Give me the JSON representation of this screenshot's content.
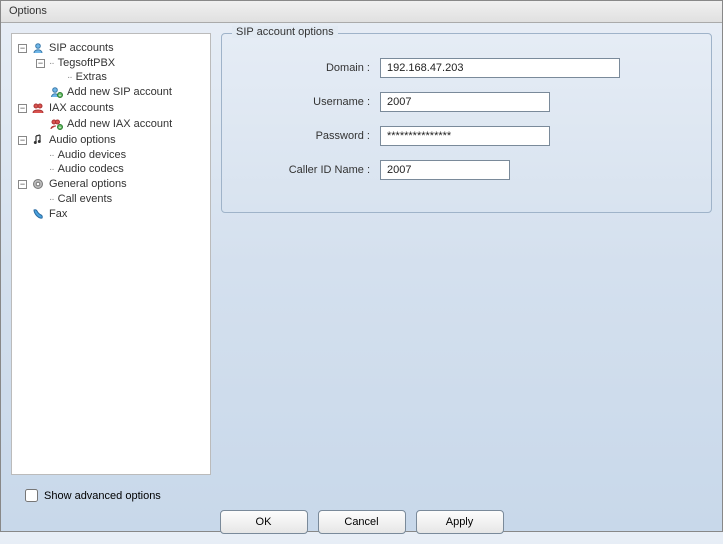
{
  "window": {
    "title": "Options"
  },
  "tree": {
    "sip_accounts": "SIP accounts",
    "tegsoft": "TegsoftPBX",
    "extras": "Extras",
    "add_sip": "Add new SIP account",
    "iax_accounts": "IAX accounts",
    "add_iax": "Add new IAX account",
    "audio_options": "Audio options",
    "audio_devices": "Audio devices",
    "audio_codecs": "Audio codecs",
    "general_options": "General options",
    "call_events": "Call events",
    "fax": "Fax"
  },
  "group": {
    "title": "SIP account options",
    "domain_label": "Domain :",
    "domain_value": "192.168.47.203",
    "username_label": "Username :",
    "username_value": "2007",
    "password_label": "Password :",
    "password_value": "***************",
    "callerid_label": "Caller ID Name :",
    "callerid_value": "2007"
  },
  "bottom": {
    "advanced_label": "Show advanced options",
    "ok": "OK",
    "cancel": "Cancel",
    "apply": "Apply"
  },
  "glyphs": {
    "minus": "−"
  }
}
